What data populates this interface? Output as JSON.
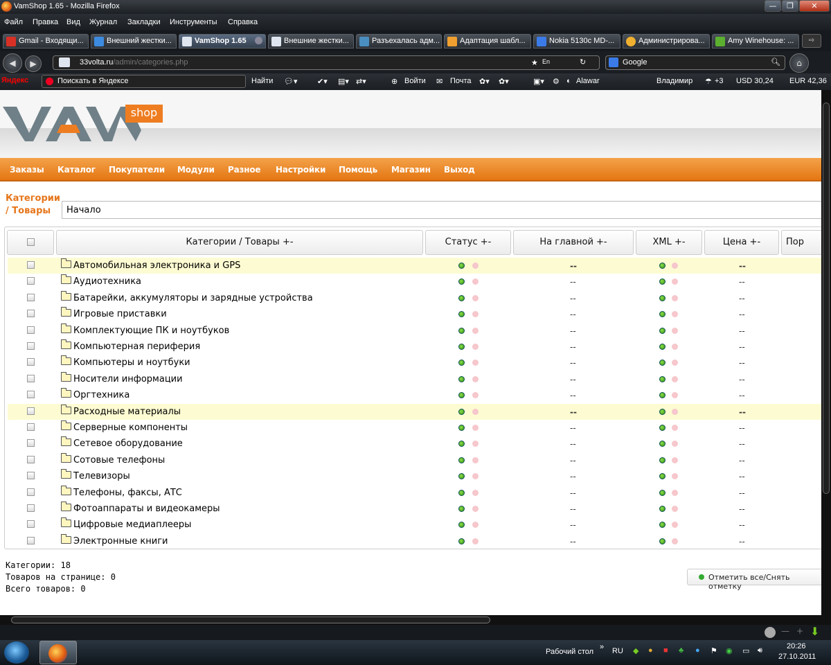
{
  "window": {
    "title": "VamShop 1.65 - Mozilla Firefox",
    "min": "—",
    "max": "❐",
    "close": "✕"
  },
  "menubar": [
    "Файл",
    "Правка",
    "Вид",
    "Журнал",
    "Закладки",
    "Инструменты",
    "Справка"
  ],
  "tabs": [
    {
      "label": "Gmail - Входящи...",
      "icon_color": "#d93025"
    },
    {
      "label": "Внешний жестки...",
      "icon_color": "#3c8be0"
    },
    {
      "label": "VamShop 1.65",
      "icon_color": "#dfe6ef",
      "active": true
    },
    {
      "label": "Внешние жестки...",
      "icon_color": "#dfe6ef"
    },
    {
      "label": "Разъехалась адм...",
      "icon_color": "#4a8fc0"
    },
    {
      "label": "Адаптация шабл...",
      "icon_color": "#f0a030"
    },
    {
      "label": "Nokia 5130c MD-...",
      "icon_color": "#3b7be8"
    },
    {
      "label": "Администрирова...",
      "icon_color": "#f0b030"
    },
    {
      "label": "Amy Winehouse: ...",
      "icon_color": "#5bb030"
    }
  ],
  "nav": {
    "host": "33volta.ru",
    "path": "/admin/categories.php",
    "search_engine": "Google",
    "lang": "En"
  },
  "yandex_bar": {
    "logo": "Яндекс",
    "search_label": "Поискать в Яндексе",
    "find": "Найти",
    "login": "Войти",
    "mail": "Почта",
    "alawar": "Alawar",
    "user": "Владимир",
    "weather": "+3",
    "usd": "USD 30,24",
    "eur": "EUR 42,36"
  },
  "site": {
    "logo_text": "VAM",
    "logo_badge": "shop",
    "menu": [
      "Заказы",
      "Каталог",
      "Покупатели",
      "Модули",
      "Разное",
      "Настройки",
      "Помощь",
      "Магазин",
      "Выход"
    ],
    "crumbs_label_1": "Категории",
    "crumbs_label_2": "/ Товары",
    "crumb": "Начало"
  },
  "table": {
    "headers": [
      "Категории / Товары +-",
      "Статус +-",
      "На главной +-",
      "XML +-",
      "Цена +-",
      "Пор"
    ],
    "rows": [
      {
        "name": "Автомобильная электроника и GPS",
        "home": "--",
        "price": "--",
        "highlight": true
      },
      {
        "name": "Аудиотехника",
        "home": "--",
        "price": "--"
      },
      {
        "name": "Батарейки, аккумуляторы и зарядные устройства",
        "home": "--",
        "price": "--"
      },
      {
        "name": "Игровые приставки",
        "home": "--",
        "price": "--"
      },
      {
        "name": "Комплектующие ПК и ноутбуков",
        "home": "--",
        "price": "--"
      },
      {
        "name": "Компьютерная периферия",
        "home": "--",
        "price": "--"
      },
      {
        "name": "Компьютеры и ноутбуки",
        "home": "--",
        "price": "--"
      },
      {
        "name": "Носители информации",
        "home": "--",
        "price": "--"
      },
      {
        "name": "Оргтехника",
        "home": "--",
        "price": "--"
      },
      {
        "name": "Расходные материалы",
        "home": "--",
        "price": "--",
        "highlight": true
      },
      {
        "name": "Серверные компоненты",
        "home": "--",
        "price": "--"
      },
      {
        "name": "Сетевое оборудование",
        "home": "--",
        "price": "--"
      },
      {
        "name": "Сотовые телефоны",
        "home": "--",
        "price": "--"
      },
      {
        "name": "Телевизоры",
        "home": "--",
        "price": "--"
      },
      {
        "name": "Телефоны, факсы, АТС",
        "home": "--",
        "price": "--"
      },
      {
        "name": "Фотоаппараты и видеокамеры",
        "home": "--",
        "price": "--"
      },
      {
        "name": "Цифровые медиаплееры",
        "home": "--",
        "price": "--"
      },
      {
        "name": "Электронные книги",
        "home": "--",
        "price": "--"
      }
    ]
  },
  "stats": {
    "categories": "Категории: 18",
    "per_page": "Товаров на странице: 0",
    "total": "Всего товаров: 0"
  },
  "select_all_button": "Отметить все/Снять отметку",
  "taskbar": {
    "desktop": "Рабочий стол",
    "lang": "RU",
    "time": "20:26",
    "date": "27.10.2011"
  },
  "colors": {
    "accent": "#e6761b",
    "menu_bar": "#ee8a2a",
    "highlight_row": "#fdfbd2"
  }
}
